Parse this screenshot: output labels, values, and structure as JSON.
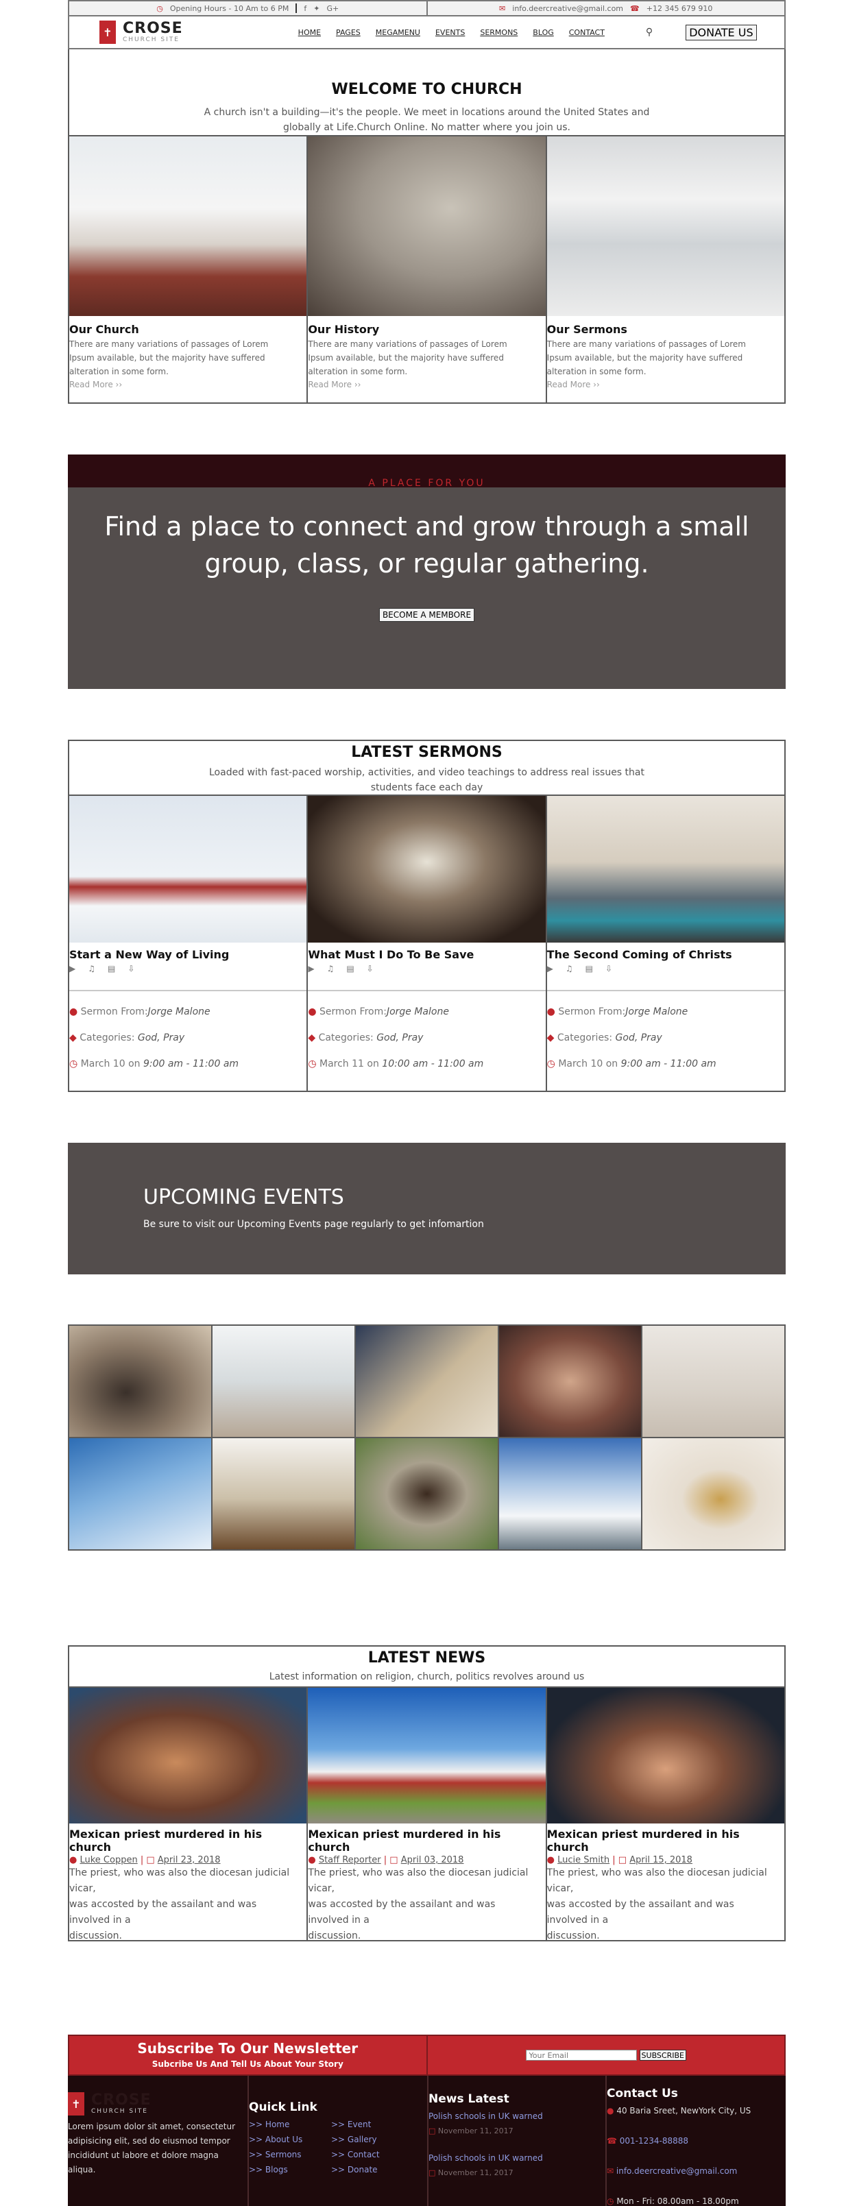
{
  "topbar": {
    "hours": "Opening Hours - 10 Am to 6 PM",
    "social": [
      "f",
      "✦",
      "G+"
    ],
    "email": "info.deercreative@gmail.com",
    "phone": "+12 345 679 910"
  },
  "header": {
    "logo_title": "CROSE",
    "logo_subtitle": "CHURCH SITE",
    "nav": [
      "HOME",
      "PAGES",
      "MEGAMENU",
      "EVENTS",
      "SERMONS",
      "BLOG",
      "CONTACT"
    ],
    "donate_label": "DONATE US"
  },
  "welcome": {
    "title": "WELCOME TO CHURCH",
    "text": "A church isn't a building—it's the people. We meet in locations around the United States and globally at Life.Church Online. No matter where you join us."
  },
  "about": [
    {
      "title": "Our Church",
      "text": "There are many variations of passages of Lorem Ipsum available, but the majority have suffered alteration in some form.",
      "more": "Read More ››"
    },
    {
      "title": "Our History",
      "text": "There are many variations of passages of Lorem Ipsum available, but the majority have suffered alteration in some form.",
      "more": "Read More ››"
    },
    {
      "title": "Our Sermons",
      "text": "There are many variations of passages of Lorem Ipsum available, but the majority have suffered alteration in some form.",
      "more": "Read More ››"
    }
  ],
  "cta": {
    "kicker": "A PLACE FOR YOU",
    "headline": "Find a place to connect and grow through a small group, class, or regular gathering.",
    "button": "BECOME A MEMBORE"
  },
  "sermons": {
    "title": "LATEST SERMONS",
    "subtitle": "Loaded with fast-paced worship, activities, and video teachings to address real issues that students face each day",
    "items": [
      {
        "title": "Start a New Way of Living",
        "from_label": "Sermon From:",
        "from": "Jorge Malone",
        "cat_label": "Categories:",
        "cats": "God, Pray",
        "date": "March 10 on",
        "time": "9:00 am - 11:00 am"
      },
      {
        "title": "What Must I Do To Be Save",
        "from_label": "Sermon From:",
        "from": "Jorge Malone",
        "cat_label": "Categories:",
        "cats": "God, Pray",
        "date": "March 11 on",
        "time": "10:00 am - 11:00 am"
      },
      {
        "title": "The Second Coming of Christs",
        "from_label": "Sermon From:",
        "from": "Jorge Malone",
        "cat_label": "Categories:",
        "cats": "God, Pray",
        "date": "March 10 on",
        "time": "9:00 am - 11:00 am"
      }
    ]
  },
  "events": {
    "title": "UPCOMING EVENTS",
    "text": "Be sure to visit our Upcoming Events page regularly to get infomartion"
  },
  "news": {
    "title": "LATEST NEWS",
    "subtitle": "Latest information on religion, church, politics revolves around us",
    "items": [
      {
        "title": "Mexican priest murdered in his church",
        "author": "Luke Coppen",
        "date": "April 23, 2018",
        "text": [
          "The priest, who was also the diocesan judicial vicar,",
          "was accosted by the assailant and was",
          "involved in a",
          "discussion."
        ]
      },
      {
        "title": "Mexican priest murdered in his church",
        "author": "Staff Reporter",
        "date": "April 03, 2018",
        "text": [
          "The priest, who was also the diocesan judicial vicar,",
          "was accosted by the assailant and was",
          "involved in a",
          "discussion."
        ]
      },
      {
        "title": "Mexican priest murdered in his church",
        "author": "Lucie Smith",
        "date": "April 15, 2018",
        "text": [
          "The priest, who was also the diocesan judicial vicar,",
          "was accosted by the assailant and was",
          "involved in a",
          "discussion."
        ]
      }
    ]
  },
  "newsletter": {
    "title": "Subscribe To Our Newsletter",
    "subtitle": "Subcribe Us And Tell Us About Your Story",
    "placeholder": "Your Email",
    "button": "SUBSCRIBE"
  },
  "footer": {
    "logo_title": "CROSE",
    "logo_subtitle": "CHURCH SITE",
    "about": "Lorem ipsum dolor sit amet, consectetur adipisicing elit, sed do eiusmod tempor incididunt ut labore et dolore magna aliqua.",
    "quick_title": "Quick Link",
    "quick_links": [
      ">> Home",
      ">> Event",
      ">> About Us",
      ">> Gallery",
      ">> Sermons",
      ">> Contact",
      ">> Blogs",
      ">> Donate"
    ],
    "news_title": "News Latest",
    "news_items": [
      {
        "title": "Polish schools in UK warned",
        "date": "November 11, 2017"
      },
      {
        "title": "Polish schools in UK warned",
        "date": "November 11, 2017"
      }
    ],
    "contact_title": "Contact Us",
    "address": "40 Baria Sreet, NewYork City, US",
    "phone": "001-1234-88888",
    "email": "info.deercreative@gmail.com",
    "hours": "Mon - Fri: 08.00am - 18.00pm"
  },
  "colors": {
    "accent": "#c0272d",
    "dark": "#534d4c",
    "footer": "#1e0a0c",
    "link": "#8f9be0"
  }
}
